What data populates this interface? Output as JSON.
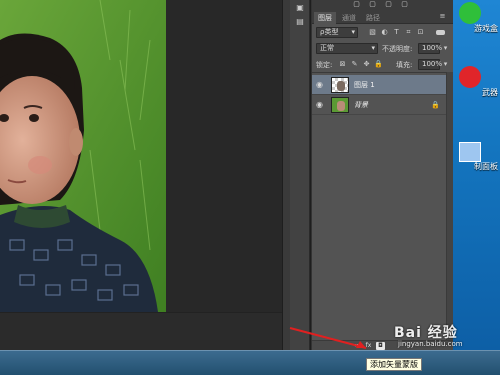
{
  "toolstrip": {
    "btn1": "▣",
    "btn2": "▤"
  },
  "panel": {
    "tabs": [
      "图层",
      "通道",
      "路径"
    ],
    "filter": {
      "kind": "ρ类型",
      "kind_arrow": "▾"
    },
    "filter_icons": [
      "▧",
      "◐",
      "T",
      "⌗",
      "⊡"
    ],
    "blend_mode": "正常",
    "opacity_label": "不透明度:",
    "opacity_value": "100%",
    "lock_label": "锁定:",
    "lock_icons": [
      "⊠",
      "✎",
      "✥",
      "🔒"
    ],
    "fill_label": "填充:",
    "fill_value": "100%",
    "layers": [
      {
        "name": "图层 1",
        "selected": true
      },
      {
        "name": "背景",
        "selected": false,
        "locked": true
      }
    ],
    "footer_buttons": [
      "fx",
      "◘"
    ]
  },
  "desktop": {
    "icons": [
      {
        "label": "游戏盒",
        "color": "#2fbf3a"
      },
      {
        "label": "武器",
        "color": "#e0252a"
      },
      {
        "label": "制面板",
        "color": "#9ec6f0"
      }
    ]
  },
  "tooltip": "添加矢量蒙版",
  "watermark": {
    "main": "Bai 经验",
    "sub": "jingyan.baidu.com"
  }
}
